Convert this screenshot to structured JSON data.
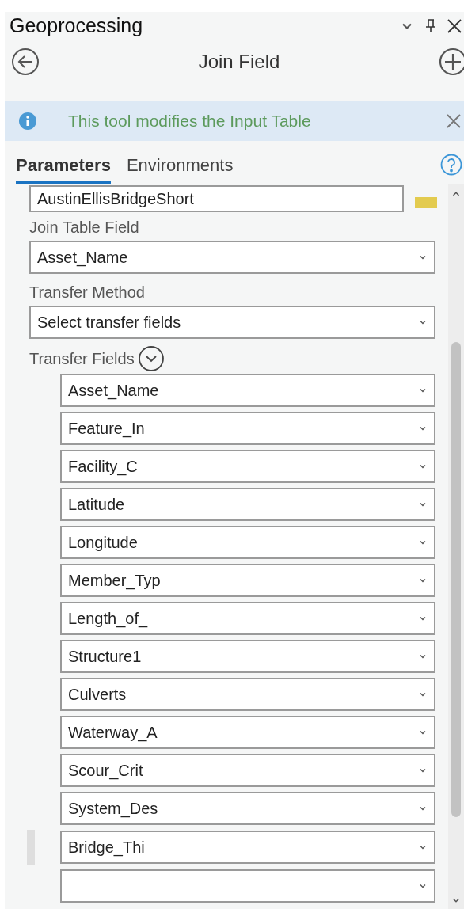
{
  "pane": {
    "title": "Geoprocessing"
  },
  "tool": {
    "title": "Join Field"
  },
  "info_bar": {
    "message": "This tool modifies the Input Table"
  },
  "tabs": [
    {
      "label": "Parameters",
      "selected": true
    },
    {
      "label": "Environments",
      "selected": false
    }
  ],
  "parameters": {
    "cut_field": {
      "value": "AustinEllisBridgeShort"
    },
    "join_table_field": {
      "label": "Join Table Field",
      "value": "Asset_Name"
    },
    "transfer_method": {
      "label": "Transfer Method",
      "value": "Select transfer fields"
    },
    "transfer_fields": {
      "label": "Transfer Fields",
      "items": [
        {
          "value": "Asset_Name",
          "hovered": false
        },
        {
          "value": "Feature_In",
          "hovered": false
        },
        {
          "value": "Facility_C",
          "hovered": false
        },
        {
          "value": "Latitude",
          "hovered": false
        },
        {
          "value": "Longitude",
          "hovered": false
        },
        {
          "value": "Member_Typ",
          "hovered": false
        },
        {
          "value": "Length_of_",
          "hovered": false
        },
        {
          "value": "Structure1",
          "hovered": false
        },
        {
          "value": "Culverts",
          "hovered": false
        },
        {
          "value": "Waterway_A",
          "hovered": false
        },
        {
          "value": "Scour_Crit",
          "hovered": false
        },
        {
          "value": "System_Des",
          "hovered": false
        },
        {
          "value": "Bridge_Thi",
          "hovered": true
        },
        {
          "hovered": false
        }
      ]
    }
  }
}
